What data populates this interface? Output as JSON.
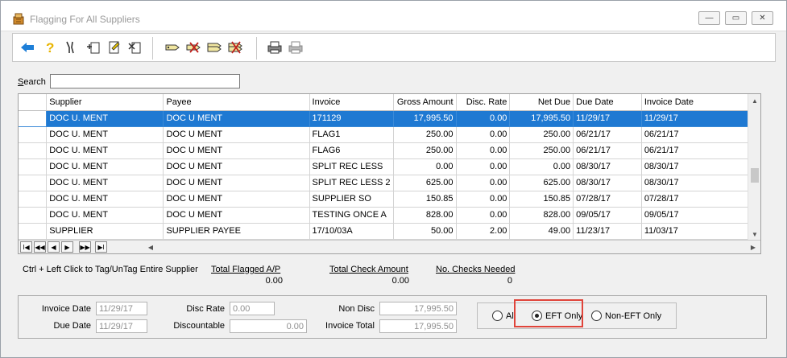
{
  "window": {
    "title": "Flagging For All Suppliers",
    "controls": {
      "minimize": "—",
      "restore": "▭",
      "close": "✕"
    }
  },
  "toolbar": {
    "buttons": [
      "back-arrow-icon",
      "help-icon",
      "tools-icon",
      "add-page-icon",
      "edit-page-icon",
      "delete-page-icon",
      "tag-icon",
      "untag-icon",
      "tag-all-icon",
      "untag-all-icon",
      "print-setup-icon",
      "print-icon"
    ]
  },
  "search": {
    "label_prefix": "",
    "label_underlined": "S",
    "label_rest": "earch",
    "value": ""
  },
  "grid": {
    "columns": [
      "Supplier",
      "Payee",
      "Invoice",
      "Gross Amount",
      "Disc. Rate",
      "Net Due",
      "Due Date",
      "Invoice Date"
    ],
    "rows": [
      [
        "DOC U. MENT",
        "DOC U MENT",
        "171129",
        "17,995.50",
        "0.00",
        "17,995.50",
        "11/29/17",
        "11/29/17"
      ],
      [
        "DOC U. MENT",
        "DOC U MENT",
        "FLAG1",
        "250.00",
        "0.00",
        "250.00",
        "06/21/17",
        "06/21/17"
      ],
      [
        "DOC U. MENT",
        "DOC U MENT",
        "FLAG6",
        "250.00",
        "0.00",
        "250.00",
        "06/21/17",
        "06/21/17"
      ],
      [
        "DOC U. MENT",
        "DOC U MENT",
        "SPLIT REC LESS",
        "0.00",
        "0.00",
        "0.00",
        "08/30/17",
        "08/30/17"
      ],
      [
        "DOC U. MENT",
        "DOC U MENT",
        "SPLIT REC LESS 2",
        "625.00",
        "0.00",
        "625.00",
        "08/30/17",
        "08/30/17"
      ],
      [
        "DOC U. MENT",
        "DOC U MENT",
        "SUPPLIER SO",
        "150.85",
        "0.00",
        "150.85",
        "07/28/17",
        "07/28/17"
      ],
      [
        "DOC U. MENT",
        "DOC U MENT",
        "TESTING ONCE A",
        "828.00",
        "0.00",
        "828.00",
        "09/05/17",
        "09/05/17"
      ],
      [
        "SUPPLIER",
        "SUPPLIER PAYEE",
        "17/10/03A",
        "50.00",
        "2.00",
        "49.00",
        "11/23/17",
        "11/03/17"
      ]
    ],
    "selected_row": 0,
    "nav": {
      "first": "I◀",
      "prev_page": "◀◀",
      "prev": "◀",
      "next": "▶",
      "next_page": "▶▶",
      "last": "▶I"
    },
    "scroll": {
      "up": "▲",
      "down": "▼",
      "left": "◀",
      "right": "▶"
    }
  },
  "summary": {
    "hint": "Ctrl + Left Click to Tag/UnTag Entire Supplier",
    "total_flagged_label": "Total Flagged A/P",
    "total_flagged_value": "0.00",
    "total_check_label": "Total Check Amount",
    "total_check_value": "0.00",
    "checks_needed_label": "No. Checks Needed",
    "checks_needed_value": "0"
  },
  "details": {
    "invoice_date_label": "Invoice Date",
    "invoice_date_value": "11/29/17",
    "due_date_label": "Due Date",
    "due_date_value": "11/29/17",
    "disc_rate_label": "Disc Rate",
    "disc_rate_value": "0.00",
    "discountable_label": "Discountable",
    "discountable_value": "0.00",
    "non_disc_label": "Non Disc",
    "non_disc_value": "17,995.50",
    "invoice_total_label": "Invoice Total",
    "invoice_total_value": "17,995.50"
  },
  "filter": {
    "options": [
      "All",
      "EFT Only",
      "Non-EFT Only"
    ],
    "selected": "EFT Only"
  },
  "colors": {
    "selection": "#1f79d2",
    "highlight": "#e0443a"
  }
}
